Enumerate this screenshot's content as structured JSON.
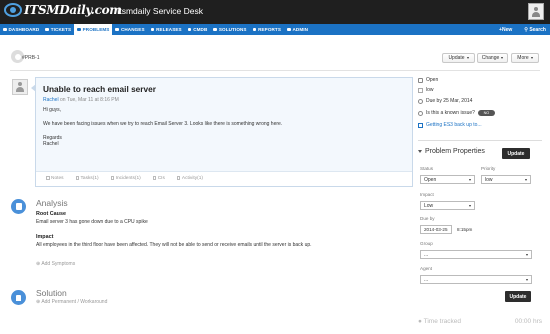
{
  "header": {
    "logo_text": "ITSMDaily.com",
    "app_title": "Itsmdaily Service Desk"
  },
  "nav": {
    "items": [
      {
        "label": "DASHBOARD",
        "active": false
      },
      {
        "label": "TICKETS",
        "active": false
      },
      {
        "label": "PROBLEMS",
        "active": true
      },
      {
        "label": "CHANGES",
        "active": false
      },
      {
        "label": "RELEASES",
        "active": false
      },
      {
        "label": "CMDB",
        "active": false
      },
      {
        "label": "SOLUTIONS",
        "active": false
      },
      {
        "label": "REPORTS",
        "active": false
      },
      {
        "label": "ADMIN",
        "active": false
      }
    ],
    "new_label": "+New",
    "search_label": "Search"
  },
  "toolbar": {
    "problem_id": "#PRB-1",
    "update_label": "Update",
    "change_label": "Change",
    "more_label": "More"
  },
  "ticket": {
    "subject": "Unable to reach email server",
    "requester": "Rachel",
    "date_text": "on Tue, Mar 11 at 8:16 PM",
    "body": [
      "Hi guys,",
      "We have been facing issues when we try to reach Email Server 3. Looks like there is something wrong here.",
      "Regards",
      "Rachel"
    ],
    "tabs": [
      "Notes",
      "Tasks(1)",
      "Incidents(1)",
      "CIs",
      "Activity(1)"
    ]
  },
  "analysis": {
    "title": "Analysis",
    "root_cause_label": "Root Cause",
    "root_cause_text": "Email server 3 has gone down due to a CPU spike",
    "impact_label": "Impact",
    "impact_text": "All employees in the third floor have been affected. They will not be able to send or receive emails until the server is back up.",
    "add_symptoms": "Add Symptoms"
  },
  "solution": {
    "title": "Solution",
    "add_permanent": "Add Permanent / Workaround"
  },
  "sidebar": {
    "status": "Open",
    "priority": "low",
    "due": "Due by 25 Mar, 2014",
    "known_issue": "Is this a known issue?",
    "known_issue_toggle": "NO",
    "related": "Getting ES3 back up to...",
    "props_title": "Problem Properties",
    "update_label": "Update",
    "status_label": "Status",
    "status_value": "Open",
    "priority_label": "Priority",
    "priority_value": "low",
    "impact_label": "Impact",
    "impact_value": "Low",
    "due_label": "Due by",
    "due_date": "2014-03-25",
    "due_time": "8:15pm",
    "group_label": "Group",
    "group_value": "...",
    "agent_label": "Agent",
    "agent_value": "...",
    "update2_label": "Update",
    "time_label": "Time tracked",
    "time_value": "00:00 hrs"
  },
  "colors": {
    "header_bg": "#1f1f1f",
    "nav_bg": "#1b72c4",
    "accent": "#1b72c4",
    "ticket_bg": "#f3f8fd"
  }
}
